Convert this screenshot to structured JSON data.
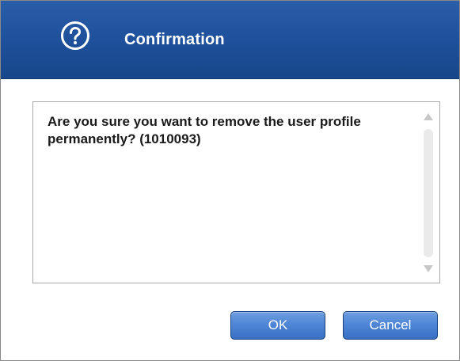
{
  "dialog": {
    "title": "Confirmation",
    "icon": "help-icon",
    "message": "Are you sure you want to remove the user profile permanently? (1010093)",
    "buttons": {
      "ok_label": "OK",
      "cancel_label": "Cancel"
    }
  },
  "colors": {
    "header": "#1d4f9a",
    "button": "#4f86d6",
    "button_border": "#1b3f78"
  }
}
